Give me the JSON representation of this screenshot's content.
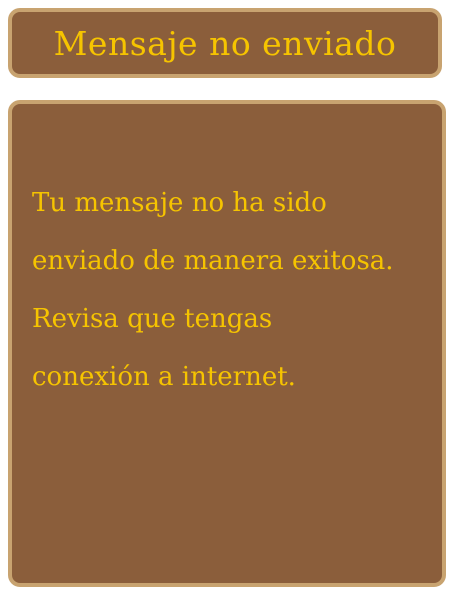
{
  "dialog": {
    "title": "Mensaje no enviado",
    "message_lines": [
      "Tu mensaje no ha sido",
      "enviado de manera exitosa.",
      "Revisa que tengas",
      "conexión a internet."
    ]
  },
  "colors": {
    "panel_fill": "#8b5e3b",
    "panel_border": "#c8a370",
    "text": "#f6c400",
    "background": "#ffffff"
  }
}
